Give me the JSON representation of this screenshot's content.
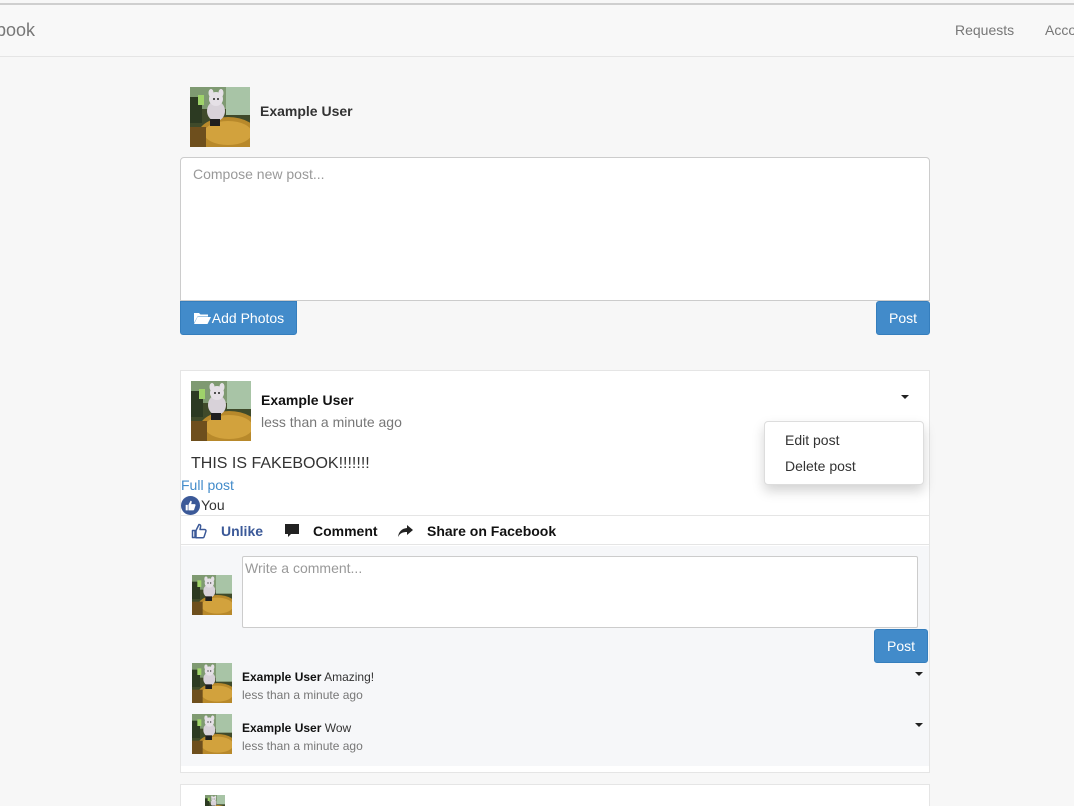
{
  "navbar": {
    "brand": "ebook",
    "links": {
      "requests": "Requests",
      "account": "Acco"
    }
  },
  "composer": {
    "user_name": "Example User",
    "placeholder": "Compose new post...",
    "add_photos_label": "Add Photos",
    "post_label": "Post"
  },
  "post": {
    "author": "Example User",
    "time": "less than a minute ago",
    "body": "THIS IS FAKEBOOK!!!!!!!",
    "full_post_link": "Full post",
    "likes_text": "You",
    "menu": {
      "edit": "Edit post",
      "delete": "Delete post"
    },
    "actions": {
      "unlike": "Unlike",
      "comment": "Comment",
      "share": "Share on Facebook"
    },
    "comment_placeholder": "Write a comment...",
    "comment_post_label": "Post",
    "comments": [
      {
        "author": "Example User",
        "text": "Amazing!",
        "time": "less than a minute ago"
      },
      {
        "author": "Example User",
        "text": "Wow",
        "time": "less than a minute ago"
      }
    ]
  },
  "icons": {
    "folder": "folder-open-icon",
    "thumbs_up": "thumbs-up-icon",
    "comment": "comment-icon",
    "share": "share-icon",
    "caret": "caret-down-icon"
  },
  "colors": {
    "primary_button": "#428bca",
    "link": "#428bca",
    "facebook_blue": "#3b5998"
  }
}
